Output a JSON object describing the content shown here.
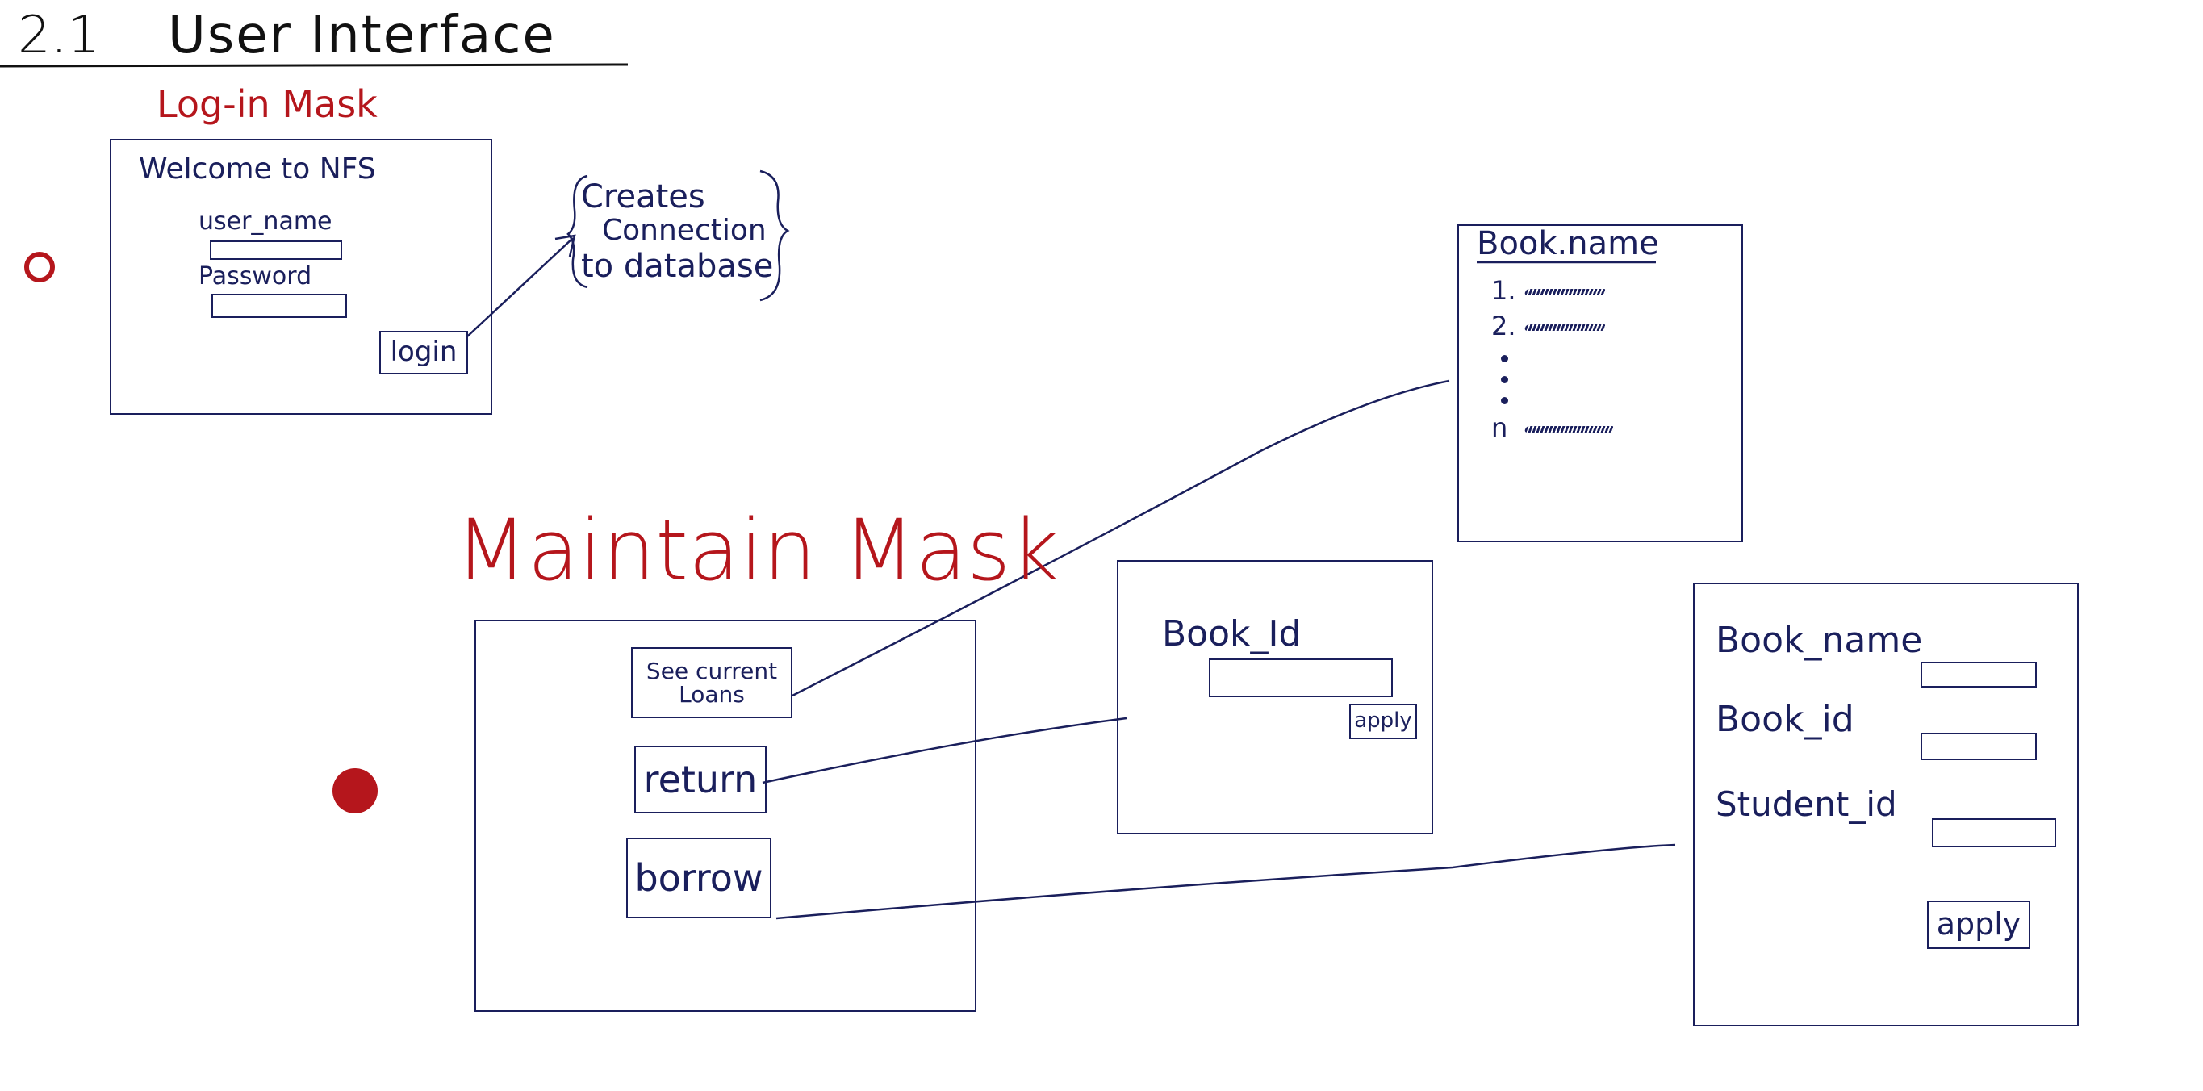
{
  "heading": {
    "number": "2.1",
    "title": "User Interface"
  },
  "login_mask": {
    "title": "Log-in Mask",
    "welcome": "Welcome to NFS",
    "user_label": "user_name",
    "password_label": "Password",
    "login_button": "login",
    "note_line1": "Creates",
    "note_line2": "Connection",
    "note_line3": "to database"
  },
  "maintain_mask": {
    "title": "Maintain Mask",
    "see_loans_button_l1": "See current",
    "see_loans_button_l2": "Loans",
    "return_button": "return",
    "borrow_button": "borrow"
  },
  "loans_list": {
    "header": "Book.name",
    "item1": "1.",
    "item2": "2.",
    "item_n": "n"
  },
  "return_panel": {
    "label": "Book_Id",
    "apply_button": "apply"
  },
  "borrow_panel": {
    "book_name_label": "Book_name",
    "book_id_label": "Book_id",
    "student_id_label": "Student_id",
    "apply_button": "apply"
  },
  "colors": {
    "ink": "#1a1f5c",
    "red": "#b5161c",
    "black": "#111111"
  }
}
